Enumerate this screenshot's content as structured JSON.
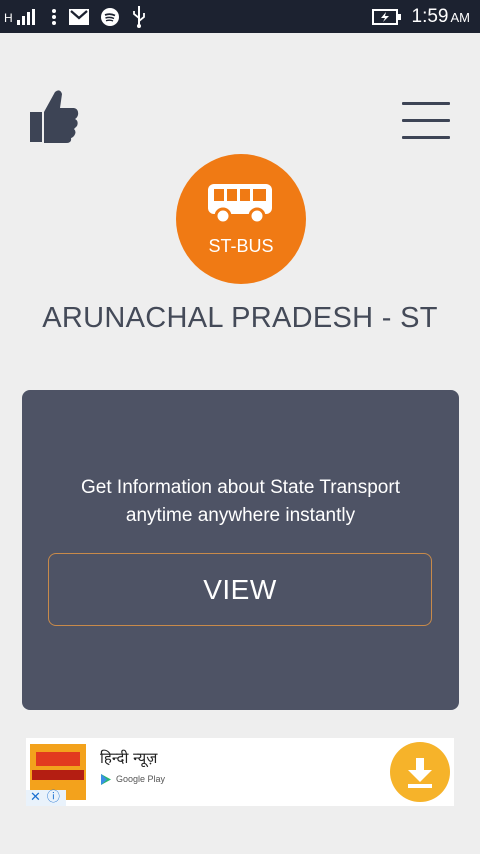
{
  "status_bar": {
    "signal_label": "H",
    "time": "1:59",
    "ampm": "AM",
    "icons": [
      "signal-icon",
      "more-icon",
      "gmail-icon",
      "spotify-icon",
      "usb-icon",
      "battery-charging-icon"
    ]
  },
  "header": {
    "like_icon": "thumbs-up-icon",
    "menu_icon": "hamburger-menu-icon"
  },
  "logo": {
    "text": "ST-BUS",
    "color": "#f07a14",
    "icon": "bus-icon"
  },
  "title": "ARUNACHAL PRADESH - ST",
  "card": {
    "description_line1": "Get Information about State Transport",
    "description_line2": "anytime anywhere instantly",
    "button_label": "VIEW",
    "background": "#4e5365"
  },
  "ad": {
    "app_name": "हिन्दी न्यूज़",
    "store": "Google Play",
    "icon": "download-icon"
  }
}
